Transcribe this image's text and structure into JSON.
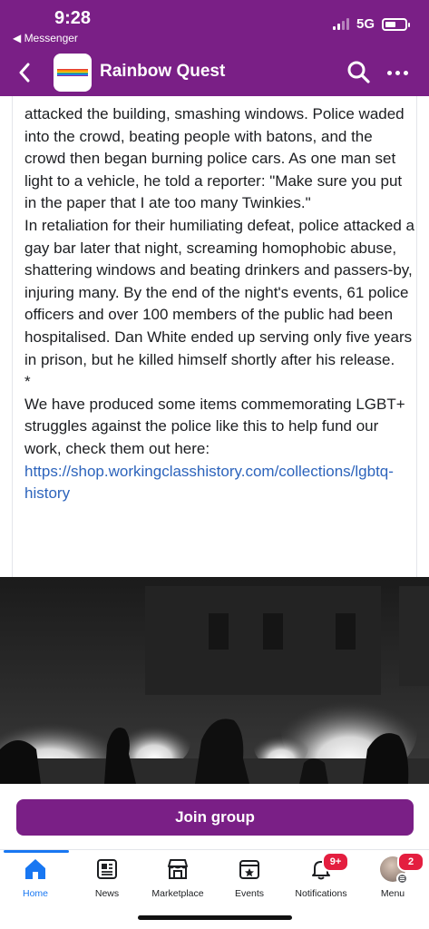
{
  "status_bar": {
    "time": "9:28",
    "back_app": "◀ Messenger",
    "network": "5G",
    "battery_level": 0.55
  },
  "header": {
    "back_icon": "chevron-left-icon",
    "group_name": "Rainbow Quest",
    "logo_colors": [
      "#e53935",
      "#fb8c00",
      "#fdd835",
      "#43a047",
      "#1e88e5",
      "#8e24aa"
    ],
    "search_icon": "search-icon",
    "more_icon": "more-icon",
    "accent": "#7a1f86"
  },
  "post": {
    "paragraphs": [
      "attacked the building, smashing windows. Police waded into the crowd, beating people with batons, and the crowd then began burning police cars. As one man set light to a vehicle, he told a reporter: \"Make sure you put in the paper that I ate too many Twinkies.\"",
      "In retaliation for their humiliating defeat, police attacked a gay bar later that night, screaming homophobic abuse, shattering windows and beating drinkers and passers-by, injuring many. By the end of the night's events, 61 police officers and over 100 members of the public had been hospitalised. Dan White ended up serving only five years in prison, but he killed himself shortly after his release.",
      "*"
    ],
    "closing_text": "We have produced some items commemorating LGBT+ struggles against the police like this to help fund our work, check them out here: ",
    "link_text": "https://shop.workingclasshistory.com/collections/lgbtq-history",
    "link_color": "#2d64bc"
  },
  "join": {
    "label": "Join group"
  },
  "nav": {
    "items": [
      {
        "label": "Home",
        "icon": "home-icon",
        "active": true
      },
      {
        "label": "News",
        "icon": "news-icon"
      },
      {
        "label": "Marketplace",
        "icon": "marketplace-icon"
      },
      {
        "label": "Events",
        "icon": "events-icon"
      },
      {
        "label": "Notifications",
        "icon": "bell-icon",
        "badge": "9+"
      },
      {
        "label": "Menu",
        "icon": "avatar-icon",
        "badge": "2"
      }
    ]
  }
}
